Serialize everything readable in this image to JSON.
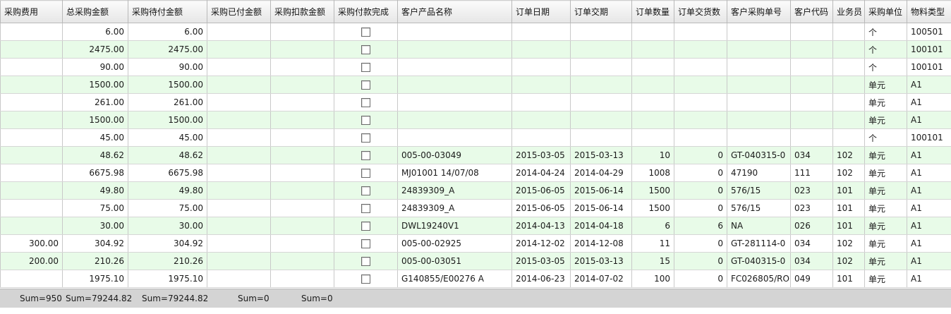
{
  "columns": [
    "采购费用",
    "总采购金额",
    "采购待付金额",
    "采购已付金额",
    "采购扣款金额",
    "采购付款完成",
    "客户产品名称",
    "订单日期",
    "订单交期",
    "订单数量",
    "订单交货数",
    "客户采购单号",
    "客户代码",
    "业务员",
    "采购单位",
    "物料类型"
  ],
  "rows": [
    {
      "fee": "",
      "total": "6.00",
      "pending": "6.00",
      "paid": "",
      "deduct": "",
      "done": false,
      "product": "",
      "order_date": "",
      "due_date": "",
      "qty": "",
      "delivered": "",
      "po_no": "",
      "cust_code": "",
      "sales": "",
      "unit": "个",
      "mat_type": "100501"
    },
    {
      "fee": "",
      "total": "2475.00",
      "pending": "2475.00",
      "paid": "",
      "deduct": "",
      "done": false,
      "product": "",
      "order_date": "",
      "due_date": "",
      "qty": "",
      "delivered": "",
      "po_no": "",
      "cust_code": "",
      "sales": "",
      "unit": "个",
      "mat_type": "100101"
    },
    {
      "fee": "",
      "total": "90.00",
      "pending": "90.00",
      "paid": "",
      "deduct": "",
      "done": false,
      "product": "",
      "order_date": "",
      "due_date": "",
      "qty": "",
      "delivered": "",
      "po_no": "",
      "cust_code": "",
      "sales": "",
      "unit": "个",
      "mat_type": "100101"
    },
    {
      "fee": "",
      "total": "1500.00",
      "pending": "1500.00",
      "paid": "",
      "deduct": "",
      "done": false,
      "product": "",
      "order_date": "",
      "due_date": "",
      "qty": "",
      "delivered": "",
      "po_no": "",
      "cust_code": "",
      "sales": "",
      "unit": "单元",
      "mat_type": "A1"
    },
    {
      "fee": "",
      "total": "261.00",
      "pending": "261.00",
      "paid": "",
      "deduct": "",
      "done": false,
      "product": "",
      "order_date": "",
      "due_date": "",
      "qty": "",
      "delivered": "",
      "po_no": "",
      "cust_code": "",
      "sales": "",
      "unit": "单元",
      "mat_type": "A1"
    },
    {
      "fee": "",
      "total": "1500.00",
      "pending": "1500.00",
      "paid": "",
      "deduct": "",
      "done": false,
      "product": "",
      "order_date": "",
      "due_date": "",
      "qty": "",
      "delivered": "",
      "po_no": "",
      "cust_code": "",
      "sales": "",
      "unit": "单元",
      "mat_type": "A1"
    },
    {
      "fee": "",
      "total": "45.00",
      "pending": "45.00",
      "paid": "",
      "deduct": "",
      "done": false,
      "product": "",
      "order_date": "",
      "due_date": "",
      "qty": "",
      "delivered": "",
      "po_no": "",
      "cust_code": "",
      "sales": "",
      "unit": "个",
      "mat_type": "100101"
    },
    {
      "fee": "",
      "total": "48.62",
      "pending": "48.62",
      "paid": "",
      "deduct": "",
      "done": false,
      "product": "005-00-03049",
      "order_date": "2015-03-05",
      "due_date": "2015-03-13",
      "qty": "10",
      "delivered": "0",
      "po_no": "GT-040315-0",
      "cust_code": "034",
      "sales": "102",
      "unit": "单元",
      "mat_type": "A1"
    },
    {
      "fee": "",
      "total": "6675.98",
      "pending": "6675.98",
      "paid": "",
      "deduct": "",
      "done": false,
      "product": "MJ01001 14/07/08",
      "order_date": "2014-04-24",
      "due_date": "2014-04-29",
      "qty": "1008",
      "delivered": "0",
      "po_no": "47190",
      "cust_code": "111",
      "sales": "102",
      "unit": "单元",
      "mat_type": "A1"
    },
    {
      "fee": "",
      "total": "49.80",
      "pending": "49.80",
      "paid": "",
      "deduct": "",
      "done": false,
      "product": "24839309_A",
      "order_date": "2015-06-05",
      "due_date": "2015-06-14",
      "qty": "1500",
      "delivered": "0",
      "po_no": "576/15",
      "cust_code": "023",
      "sales": "101",
      "unit": "单元",
      "mat_type": "A1"
    },
    {
      "fee": "",
      "total": "75.00",
      "pending": "75.00",
      "paid": "",
      "deduct": "",
      "done": false,
      "product": "24839309_A",
      "order_date": "2015-06-05",
      "due_date": "2015-06-14",
      "qty": "1500",
      "delivered": "0",
      "po_no": "576/15",
      "cust_code": "023",
      "sales": "101",
      "unit": "单元",
      "mat_type": "A1"
    },
    {
      "fee": "",
      "total": "30.00",
      "pending": "30.00",
      "paid": "",
      "deduct": "",
      "done": false,
      "product": "DWL19240V1",
      "order_date": "2014-04-13",
      "due_date": "2014-04-18",
      "qty": "6",
      "delivered": "6",
      "po_no": "NA",
      "cust_code": "026",
      "sales": "101",
      "unit": "单元",
      "mat_type": "A1"
    },
    {
      "fee": "300.00",
      "total": "304.92",
      "pending": "304.92",
      "paid": "",
      "deduct": "",
      "done": false,
      "product": "005-00-02925",
      "order_date": "2014-12-02",
      "due_date": "2014-12-08",
      "qty": "11",
      "delivered": "0",
      "po_no": "GT-281114-0",
      "cust_code": "034",
      "sales": "102",
      "unit": "单元",
      "mat_type": "A1"
    },
    {
      "fee": "200.00",
      "total": "210.26",
      "pending": "210.26",
      "paid": "",
      "deduct": "",
      "done": false,
      "product": "005-00-03051",
      "order_date": "2015-03-05",
      "due_date": "2015-03-13",
      "qty": "15",
      "delivered": "0",
      "po_no": "GT-040315-0",
      "cust_code": "034",
      "sales": "102",
      "unit": "单元",
      "mat_type": "A1"
    },
    {
      "fee": "",
      "total": "1975.10",
      "pending": "1975.10",
      "paid": "",
      "deduct": "",
      "done": false,
      "product": "G140855/E00276 A",
      "order_date": "2014-06-23",
      "due_date": "2014-07-02",
      "qty": "100",
      "delivered": "0",
      "po_no": "FC026805/ROD",
      "cust_code": "049",
      "sales": "101",
      "unit": "单元",
      "mat_type": "A1"
    }
  ],
  "footer": {
    "fee_sum": "Sum=950",
    "total_sum": "Sum=79244.82",
    "pending_sum": "Sum=79244.82",
    "paid_sum": "Sum=0",
    "deduct_sum": "Sum=0"
  }
}
